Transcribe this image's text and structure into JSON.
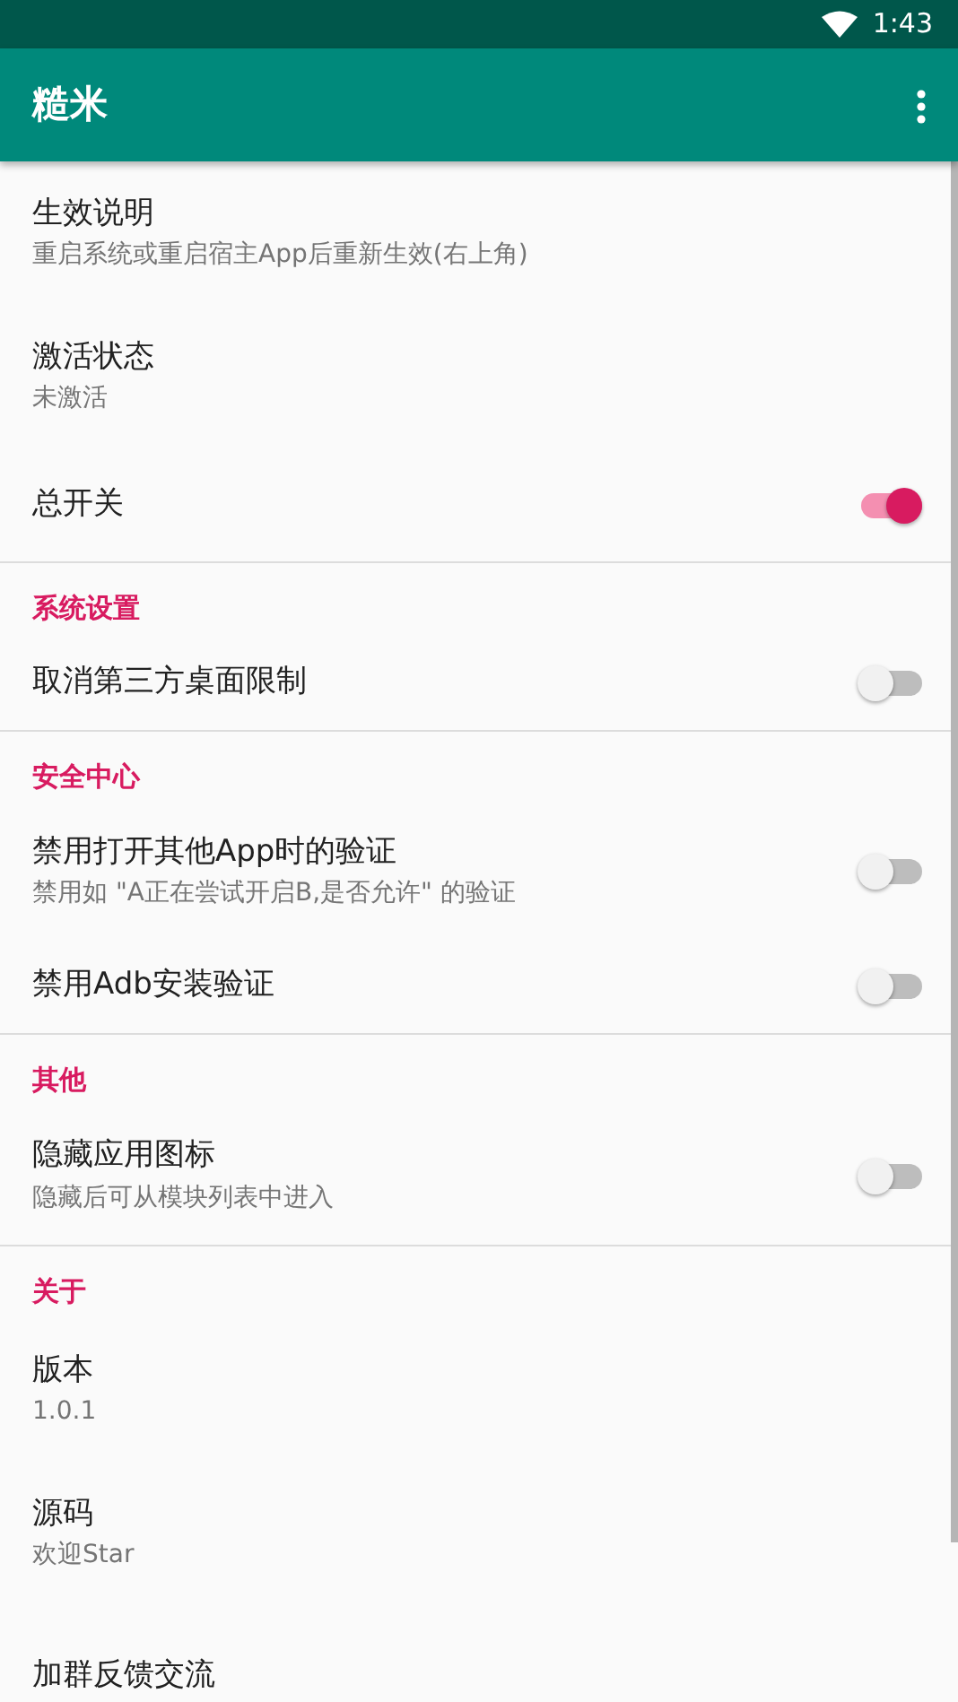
{
  "status_bar": {
    "time": "1:43"
  },
  "toolbar": {
    "title": "糙米"
  },
  "sections": [
    {
      "items": [
        {
          "kind": "text",
          "title": "生效说明",
          "summary": "重启系统或重启宿主App后重新生效(右上角)"
        },
        {
          "kind": "text",
          "title": "激活状态",
          "summary": "未激活"
        },
        {
          "kind": "switch",
          "title": "总开关",
          "on": true
        }
      ]
    },
    {
      "header": "系统设置",
      "items": [
        {
          "kind": "switch",
          "title": "取消第三方桌面限制",
          "on": false
        }
      ]
    },
    {
      "header": "安全中心",
      "items": [
        {
          "kind": "switch",
          "title": "禁用打开其他App时的验证",
          "summary": "禁用如 \"A正在尝试开启B,是否允许\" 的验证",
          "on": false
        },
        {
          "kind": "switch",
          "title": "禁用Adb安装验证",
          "on": false
        }
      ]
    },
    {
      "header": "其他",
      "items": [
        {
          "kind": "switch",
          "title": "隐藏应用图标",
          "summary": "隐藏后可从模块列表中进入",
          "on": false
        }
      ]
    },
    {
      "header": "关于",
      "items": [
        {
          "kind": "text",
          "title": "版本",
          "summary": "1.0.1"
        },
        {
          "kind": "text",
          "title": "源码",
          "summary": "欢迎Star"
        },
        {
          "kind": "text",
          "title": "加群反馈交流"
        }
      ]
    }
  ]
}
